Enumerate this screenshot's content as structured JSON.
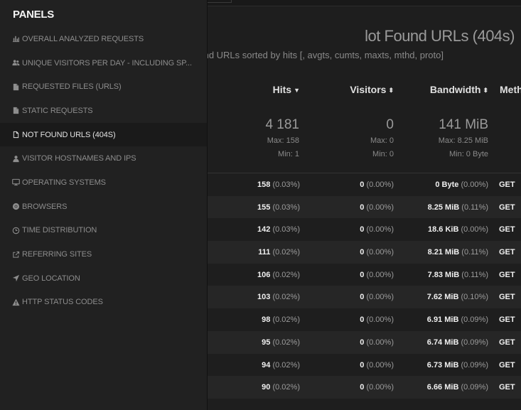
{
  "panel": {
    "title": "PANELS",
    "items": [
      {
        "label": "OVERALL ANALYZED REQUESTS",
        "icon": "bar-chart-icon",
        "active": false
      },
      {
        "label": "UNIQUE VISITORS PER DAY - INCLUDING SP...",
        "icon": "users-icon",
        "active": false
      },
      {
        "label": "REQUESTED FILES (URLS)",
        "icon": "file-icon",
        "active": false
      },
      {
        "label": "STATIC REQUESTS",
        "icon": "file-icon",
        "active": false
      },
      {
        "label": "NOT FOUND URLS (404S)",
        "icon": "file-outline-icon",
        "active": true
      },
      {
        "label": "VISITOR HOSTNAMES AND IPS",
        "icon": "user-icon",
        "active": false
      },
      {
        "label": "OPERATING SYSTEMS",
        "icon": "desktop-icon",
        "active": false
      },
      {
        "label": "BROWSERS",
        "icon": "chrome-icon",
        "active": false
      },
      {
        "label": "TIME DISTRIBUTION",
        "icon": "clock-icon",
        "active": false
      },
      {
        "label": "REFERRING SITES",
        "icon": "external-link-icon",
        "active": false
      },
      {
        "label": "GEO LOCATION",
        "icon": "location-arrow-icon",
        "active": false
      },
      {
        "label": "HTTP STATUS CODES",
        "icon": "warning-icon",
        "active": false
      }
    ]
  },
  "main": {
    "title": "lot Found URLs (404s)",
    "subtitle": "ot found URLs sorted by hits [, avgts, cumts, maxts, mthd, proto]",
    "columns": {
      "hits": "Hits",
      "visitors": "Visitors",
      "bandwidth": "Bandwidth",
      "method": "Meth"
    },
    "summary": {
      "hits": {
        "total": "4 181",
        "max": "Max: 158",
        "min": "Min: 1"
      },
      "visitors": {
        "total": "0",
        "max": "Max: 0",
        "min": "Min: 0"
      },
      "bandwidth": {
        "total": "141 MiB",
        "max": "Max: 8.25 MiB",
        "min": "Min: 0 Byte"
      }
    },
    "rows": [
      {
        "hits": "158",
        "hits_pct": "(0.03%)",
        "visitors": "0",
        "visitors_pct": "(0.00%)",
        "bw": "0 Byte",
        "bw_pct": "(0.00%)",
        "method": "GET"
      },
      {
        "hits": "155",
        "hits_pct": "(0.03%)",
        "visitors": "0",
        "visitors_pct": "(0.00%)",
        "bw": "8.25 MiB",
        "bw_pct": "(0.11%)",
        "method": "GET"
      },
      {
        "hits": "142",
        "hits_pct": "(0.03%)",
        "visitors": "0",
        "visitors_pct": "(0.00%)",
        "bw": "18.6 KiB",
        "bw_pct": "(0.00%)",
        "method": "GET"
      },
      {
        "hits": "111",
        "hits_pct": "(0.02%)",
        "visitors": "0",
        "visitors_pct": "(0.00%)",
        "bw": "8.21 MiB",
        "bw_pct": "(0.11%)",
        "method": "GET"
      },
      {
        "hits": "106",
        "hits_pct": "(0.02%)",
        "visitors": "0",
        "visitors_pct": "(0.00%)",
        "bw": "7.83 MiB",
        "bw_pct": "(0.11%)",
        "method": "GET"
      },
      {
        "hits": "103",
        "hits_pct": "(0.02%)",
        "visitors": "0",
        "visitors_pct": "(0.00%)",
        "bw": "7.62 MiB",
        "bw_pct": "(0.10%)",
        "method": "GET"
      },
      {
        "hits": "98",
        "hits_pct": "(0.02%)",
        "visitors": "0",
        "visitors_pct": "(0.00%)",
        "bw": "6.91 MiB",
        "bw_pct": "(0.09%)",
        "method": "GET"
      },
      {
        "hits": "95",
        "hits_pct": "(0.02%)",
        "visitors": "0",
        "visitors_pct": "(0.00%)",
        "bw": "6.74 MiB",
        "bw_pct": "(0.09%)",
        "method": "GET"
      },
      {
        "hits": "94",
        "hits_pct": "(0.02%)",
        "visitors": "0",
        "visitors_pct": "(0.00%)",
        "bw": "6.73 MiB",
        "bw_pct": "(0.09%)",
        "method": "GET"
      },
      {
        "hits": "90",
        "hits_pct": "(0.02%)",
        "visitors": "0",
        "visitors_pct": "(0.00%)",
        "bw": "6.66 MiB",
        "bw_pct": "(0.09%)",
        "method": "GET"
      }
    ]
  },
  "colors": {
    "panel_bg": "#212121",
    "main_bg": "#1e1e1e",
    "active_item_bg": "#1a1a1a"
  }
}
